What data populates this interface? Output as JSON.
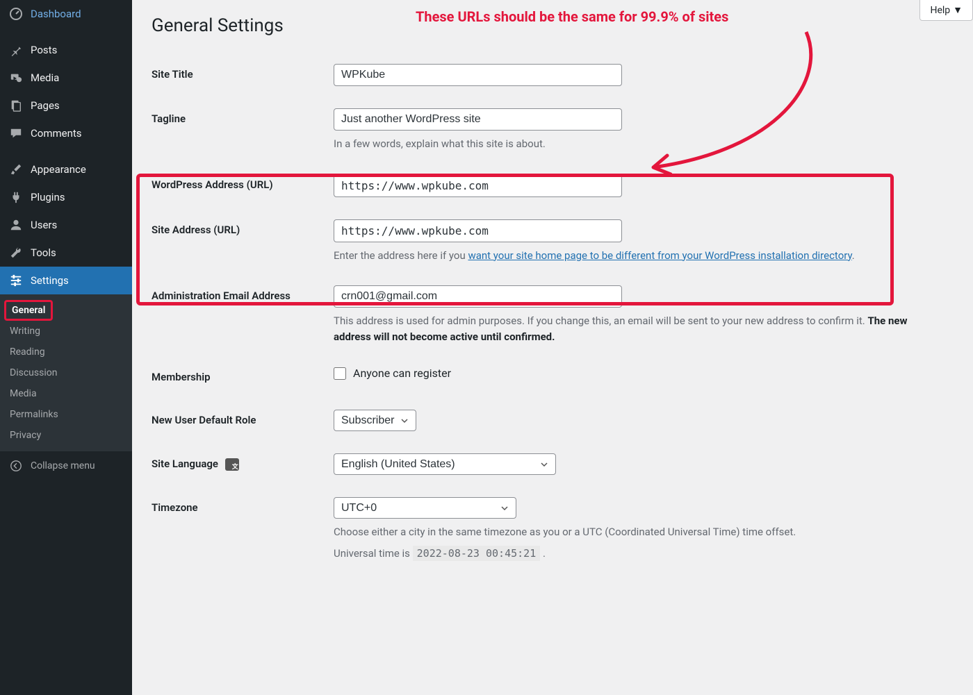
{
  "help": "Help",
  "page_title": "General Settings",
  "annotation": "These URLs should be the same for 99.9% of sites",
  "sidebar": {
    "items": [
      {
        "label": "Dashboard"
      },
      {
        "label": "Posts"
      },
      {
        "label": "Media"
      },
      {
        "label": "Pages"
      },
      {
        "label": "Comments"
      },
      {
        "label": "Appearance"
      },
      {
        "label": "Plugins"
      },
      {
        "label": "Users"
      },
      {
        "label": "Tools"
      },
      {
        "label": "Settings"
      }
    ],
    "submenu": [
      "General",
      "Writing",
      "Reading",
      "Discussion",
      "Media",
      "Permalinks",
      "Privacy"
    ],
    "collapse": "Collapse menu"
  },
  "fields": {
    "site_title": {
      "label": "Site Title",
      "value": "WPKube"
    },
    "tagline": {
      "label": "Tagline",
      "value": "Just another WordPress site",
      "desc": "In a few words, explain what this site is about."
    },
    "wp_url": {
      "label": "WordPress Address (URL)",
      "value": "https://www.wpkube.com"
    },
    "site_url": {
      "label": "Site Address (URL)",
      "value": "https://www.wpkube.com",
      "desc_pre": "Enter the address here if you ",
      "desc_link": "want your site home page to be different from your WordPress installation directory",
      "desc_post": "."
    },
    "admin_email": {
      "label": "Administration Email Address",
      "value": "crn001@gmail.com",
      "desc_pre": "This address is used for admin purposes. If you change this, an email will be sent to your new address to confirm it. ",
      "desc_strong": "The new address will not become active until confirmed."
    },
    "membership": {
      "label": "Membership",
      "check_label": "Anyone can register"
    },
    "default_role": {
      "label": "New User Default Role",
      "value": "Subscriber"
    },
    "language": {
      "label": "Site Language",
      "value": "English (United States)"
    },
    "timezone": {
      "label": "Timezone",
      "value": "UTC+0",
      "desc": "Choose either a city in the same timezone as you or a UTC (Coordinated Universal Time) time offset.",
      "universal_pre": "Universal time is ",
      "universal_time": "2022-08-23 00:45:21",
      "universal_post": " ."
    }
  }
}
